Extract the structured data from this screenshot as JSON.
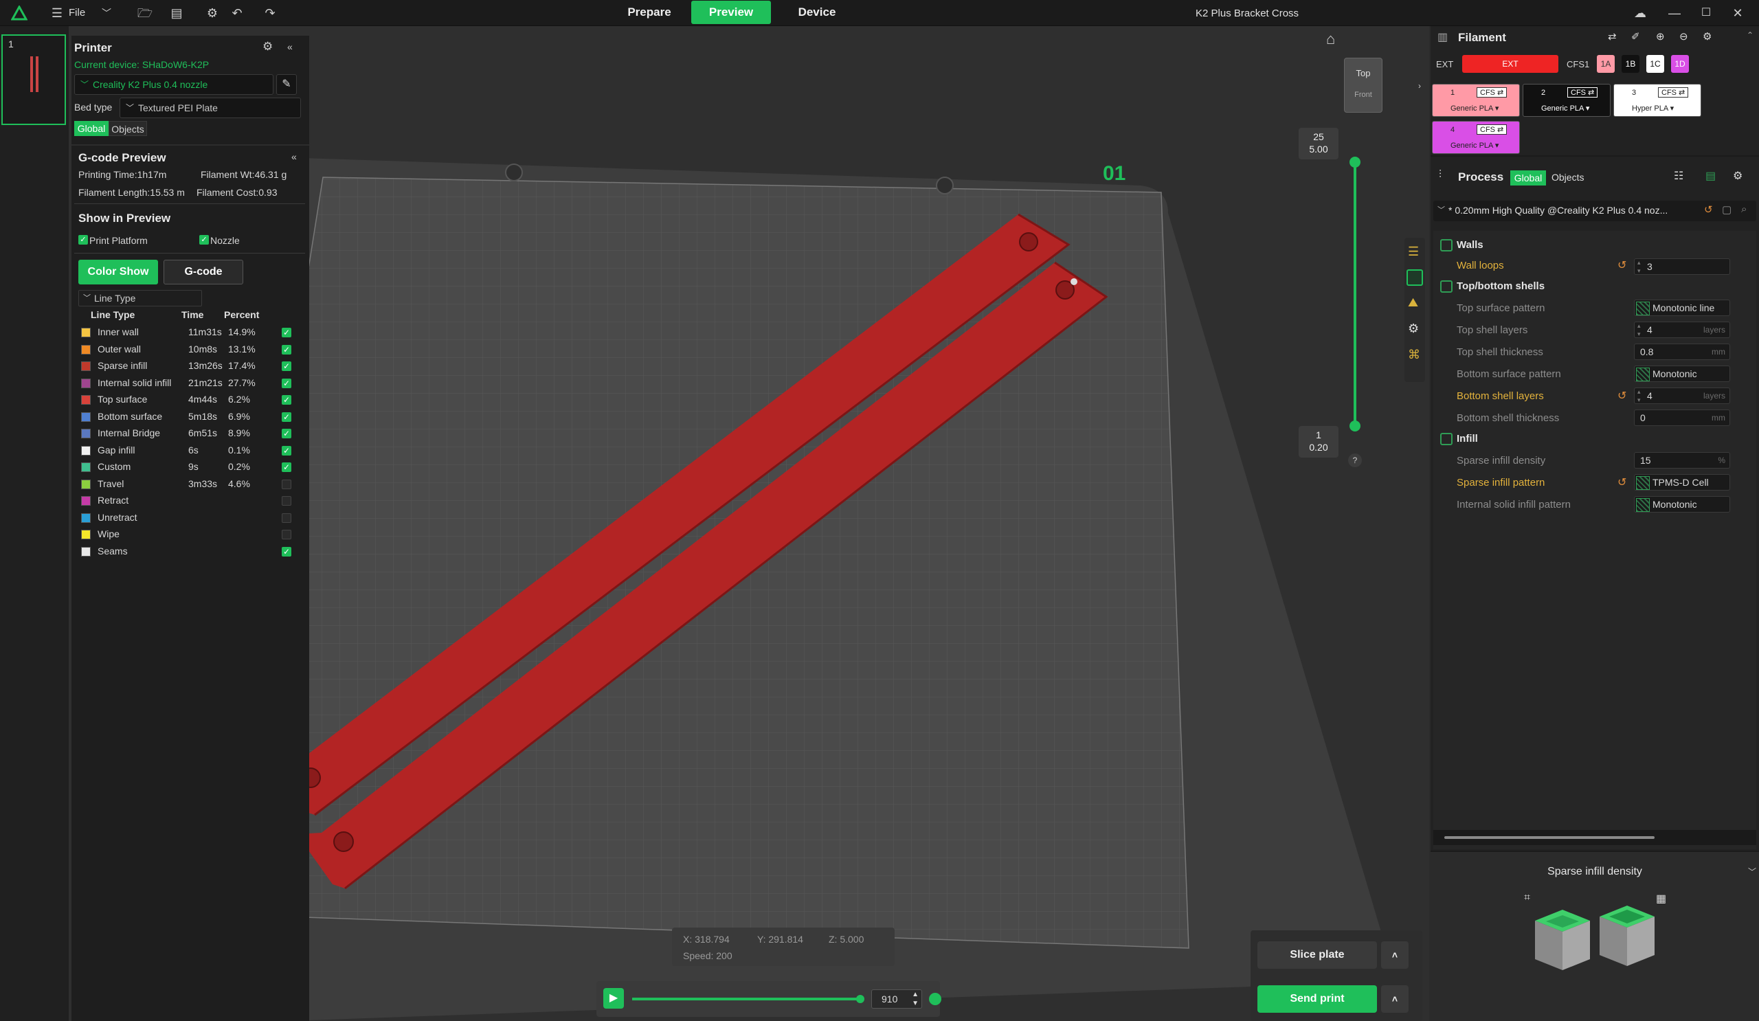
{
  "topbar": {
    "file_label": "File",
    "tabs": [
      "Prepare",
      "Preview",
      "Device"
    ],
    "active_tab": "Preview",
    "window_title": "K2 Plus Bracket Cross"
  },
  "plate_thumb": {
    "index": "1"
  },
  "printer": {
    "title": "Printer",
    "current_device": "Current device: SHaDoW6-K2P",
    "preset": "Creality K2 Plus 0.4 nozzle",
    "bed_type_label": "Bed type",
    "bed_type_value": "Textured PEI Plate",
    "seg_global": "Global",
    "seg_objects": "Objects"
  },
  "gcode_preview": {
    "title": "G-code Preview",
    "printing_time": "Printing Time:1h17m",
    "filament_wt": "Filament Wt:46.31 g",
    "filament_length": "Filament Length:15.53 m",
    "filament_cost": "Filament Cost:0.93",
    "show_in_preview": "Show in Preview",
    "print_platform": "Print Platform",
    "nozzle": "Nozzle",
    "btn_color_show": "Color Show",
    "btn_gcode": "G-code",
    "line_type_dropdown": "Line Type",
    "col_line_type": "Line Type",
    "col_time": "Time",
    "col_percent": "Percent",
    "rows": [
      {
        "name": "Inner wall",
        "time": "11m31s",
        "pct": "14.9%",
        "color": "#f5c542",
        "checked": true
      },
      {
        "name": "Outer wall",
        "time": "10m8s",
        "pct": "13.1%",
        "color": "#f08a24",
        "checked": true
      },
      {
        "name": "Sparse infill",
        "time": "13m26s",
        "pct": "17.4%",
        "color": "#c0392b",
        "checked": true
      },
      {
        "name": "Internal solid infill",
        "time": "21m21s",
        "pct": "27.7%",
        "color": "#a0458f",
        "checked": true
      },
      {
        "name": "Top surface",
        "time": "4m44s",
        "pct": "6.2%",
        "color": "#d9423a",
        "checked": true
      },
      {
        "name": "Bottom surface",
        "time": "5m18s",
        "pct": "6.9%",
        "color": "#4f7fd1",
        "checked": true
      },
      {
        "name": "Internal Bridge",
        "time": "6m51s",
        "pct": "8.9%",
        "color": "#5a78c0",
        "checked": true
      },
      {
        "name": "Gap infill",
        "time": "6s",
        "pct": "0.1%",
        "color": "#f0f0f0",
        "checked": true
      },
      {
        "name": "Custom",
        "time": "9s",
        "pct": "0.2%",
        "color": "#3fbf8f",
        "checked": true
      },
      {
        "name": "Travel",
        "time": "3m33s",
        "pct": "4.6%",
        "color": "#8ccf3f",
        "checked": false
      },
      {
        "name": "Retract",
        "time": "",
        "pct": "",
        "color": "#c53aa6",
        "checked": false
      },
      {
        "name": "Unretract",
        "time": "",
        "pct": "",
        "color": "#2a9fd6",
        "checked": false
      },
      {
        "name": "Wipe",
        "time": "",
        "pct": "",
        "color": "#f5e72a",
        "checked": false
      },
      {
        "name": "Seams",
        "time": "",
        "pct": "",
        "color": "#e8e8e8",
        "checked": true
      }
    ]
  },
  "viewport": {
    "plate_number": "01",
    "view_cube_top": "Top",
    "view_cube_front": "Front",
    "layer_top": "25",
    "layer_top_height": "5.00",
    "layer_bottom": "1",
    "layer_bottom_height": "0.20",
    "help": "?",
    "coord_x": "X: 318.794",
    "coord_y": "Y: 291.814",
    "coord_z": "Z: 5.000",
    "speed": "Speed: 200",
    "move_value": "910",
    "move_progress": 0.98
  },
  "filament": {
    "title": "Filament",
    "ext_label": "EXT",
    "ext_button": "EXT",
    "cfs_label": "CFS1",
    "slots_tabs": [
      "1A",
      "1B",
      "1C",
      "1D"
    ],
    "slots": [
      {
        "num": "1",
        "tag": "CFS ⇄",
        "name": "Generic PLA ▾",
        "color": "#ff9aa6"
      },
      {
        "num": "2",
        "tag": "CFS ⇄",
        "name": "Generic PLA ▾",
        "color": "#111111"
      },
      {
        "num": "3",
        "tag": "CFS ⇄",
        "name": "Hyper PLA ▾",
        "color": "#ffffff"
      },
      {
        "num": "4",
        "tag": "CFS ⇄",
        "name": "Generic PLA ▾",
        "color": "#d94fe6"
      }
    ]
  },
  "process": {
    "title": "Process",
    "seg_global": "Global",
    "seg_objects": "Objects",
    "preset": "* 0.20mm High Quality @Creality K2 Plus 0.4 noz...",
    "sections": {
      "walls": "Walls",
      "top_bottom": "Top/bottom shells",
      "infill": "Infill"
    },
    "wall_loops_label": "Wall loops",
    "wall_loops_value": "3",
    "top_surface_pattern_label": "Top surface pattern",
    "top_surface_pattern_value": "Monotonic line",
    "top_shell_layers_label": "Top shell layers",
    "top_shell_layers_value": "4",
    "top_shell_thickness_label": "Top shell thickness",
    "top_shell_thickness_value": "0.8",
    "bottom_surface_pattern_label": "Bottom surface pattern",
    "bottom_surface_pattern_value": "Monotonic",
    "bottom_shell_layers_label": "Bottom shell layers",
    "bottom_shell_layers_value": "4",
    "bottom_shell_thickness_label": "Bottom shell thickness",
    "bottom_shell_thickness_value": "0",
    "sparse_density_label": "Sparse infill density",
    "sparse_density_value": "15",
    "sparse_pattern_label": "Sparse infill pattern",
    "sparse_pattern_value": "TPMS-D Cell",
    "internal_solid_label": "Internal solid infill pattern",
    "internal_solid_value": "Monotonic",
    "unit_layers": "layers",
    "unit_mm": "mm",
    "unit_pct": "%"
  },
  "help_panel": {
    "title": "Sparse infill density"
  },
  "actions": {
    "slice_plate": "Slice plate",
    "send_print": "Send print"
  }
}
